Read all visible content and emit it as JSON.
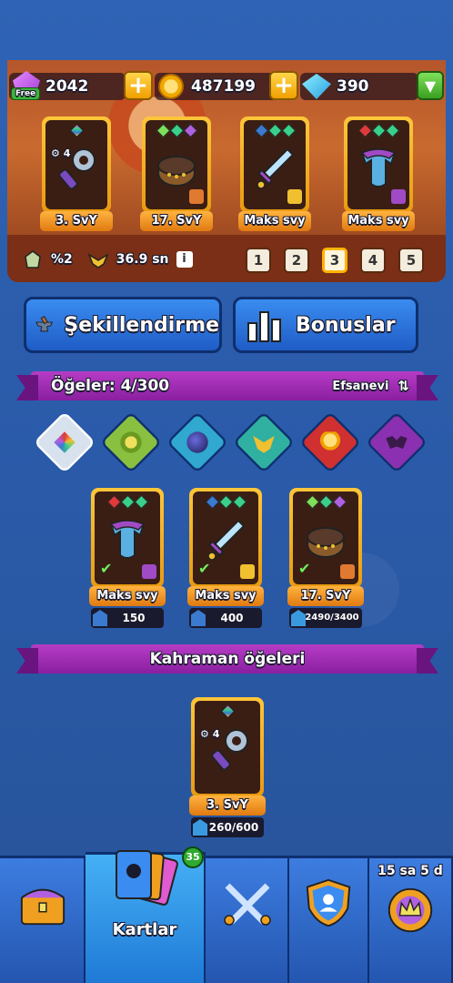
{
  "currency": {
    "gems": "2042",
    "gems_free_label": "Free",
    "coins": "487199",
    "crystals": "390"
  },
  "equipped": [
    {
      "level": "3. SvY",
      "stat": "4",
      "dots": [
        "#e05ad0",
        "#3ad08a"
      ]
    },
    {
      "level": "17. SvY",
      "dots": [
        "#7ee05a",
        "#3ad08a",
        "#b060e0"
      ]
    },
    {
      "level": "Maks svy",
      "dots": [
        "#3a7ad0",
        "#3ad08a",
        "#3ad08a"
      ]
    },
    {
      "level": "Maks svy",
      "dots": [
        "#e03a3a",
        "#3ad08a",
        "#3ad08a"
      ]
    }
  ],
  "stats": {
    "percent": "%2",
    "time": "36.9 sn",
    "info": "i"
  },
  "pages": [
    "1",
    "2",
    "3",
    "4",
    "5"
  ],
  "active_page": "3",
  "buttons": {
    "forge": "Şekillendirme",
    "bonuses": "Bonuslar"
  },
  "items_header": {
    "title": "Öğeler: 4/300",
    "sort": "Efsanevi"
  },
  "filters": [
    "all-filter-icon",
    "nature-filter-icon",
    "ball-filter-icon",
    "eagle-filter-icon",
    "bulb-filter-icon",
    "bat-filter-icon"
  ],
  "items": [
    {
      "level": "Maks svy",
      "count": "150",
      "dots": [
        "#e03a3a",
        "#3ad08a",
        "#3ad08a"
      ]
    },
    {
      "level": "Maks svy",
      "count": "400",
      "dots": [
        "#3a7ad0",
        "#3ad08a",
        "#3ad08a"
      ]
    },
    {
      "level": "17. SvY",
      "count": "2490/3400",
      "dots": [
        "#7ee05a",
        "#3ad08a",
        "#b060e0"
      ]
    }
  ],
  "hero_items_header": "Kahraman öğeleri",
  "hero_items": [
    {
      "level": "3. SvY",
      "stat": "4",
      "count": "260/600"
    }
  ],
  "nav": {
    "cards_label": "Kartlar",
    "cards_badge": "35",
    "timer": "15 sa 5 d"
  },
  "colors": {
    "accent_gold": "#ffc63a",
    "ribbon_purple": "#b63cc6",
    "button_blue": "#3a8cf0"
  }
}
